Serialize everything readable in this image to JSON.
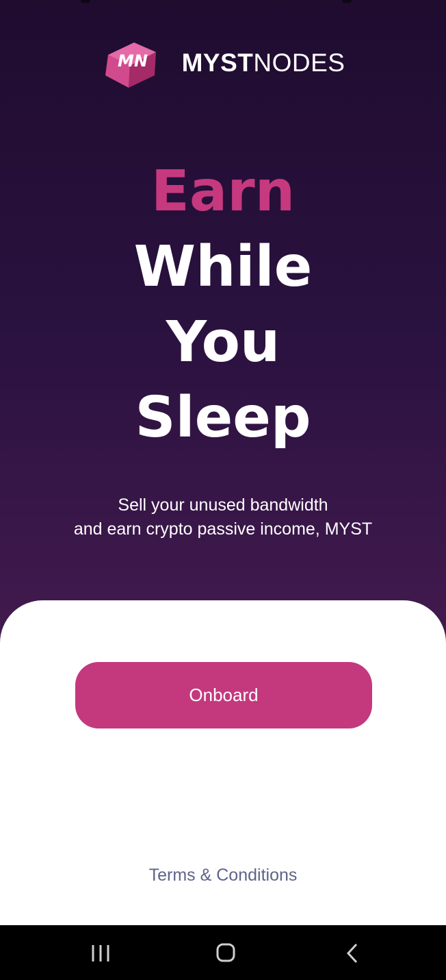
{
  "brand": {
    "logo_letters": "MN",
    "name_bold": "MYST",
    "name_light": "NODES",
    "colors": {
      "accent": "#c4387e",
      "cube_light": "#e25aa0",
      "cube_dark": "#a42a68"
    }
  },
  "hero": {
    "line1": "Earn",
    "line2": "While",
    "line3": "You",
    "line4": "Sleep"
  },
  "subtitle": {
    "line1": "Sell your unused bandwidth",
    "line2": "and earn crypto passive income, MYST"
  },
  "actions": {
    "onboard_label": "Onboard",
    "terms_label": "Terms & Conditions"
  },
  "system_nav": {
    "icons": [
      "recent-apps-icon",
      "home-icon",
      "back-icon"
    ]
  }
}
